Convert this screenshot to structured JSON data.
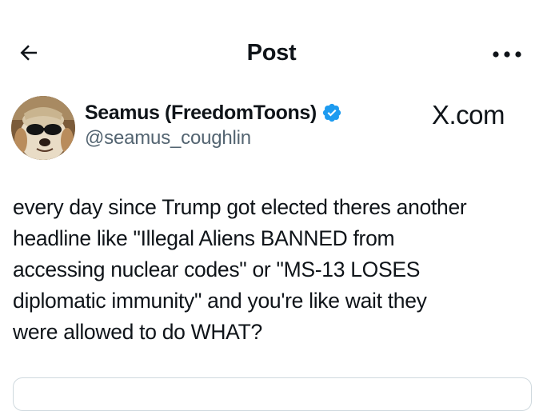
{
  "header": {
    "title": "Post",
    "back_icon": "arrow-left-icon",
    "more_icon": "more-horizontal-icon"
  },
  "author": {
    "display_name": "Seamus (FreedomToons)",
    "handle": "@seamus_coughlin",
    "verified": true,
    "avatar_icon": "dog-with-sunglasses-avatar"
  },
  "brand": {
    "label": "X.com"
  },
  "post": {
    "text": "every day since Trump got elected theres another\nheadline like \"Illegal Aliens BANNED from\naccessing nuclear codes\" or \"MS-13 LOSES\ndiplomatic immunity\" and you're like wait they\nwere allowed to do WHAT?"
  },
  "colors": {
    "text_primary": "#0f1419",
    "text_secondary": "#536471",
    "verified_blue": "#1d9bf0",
    "border": "#cfd9de"
  }
}
